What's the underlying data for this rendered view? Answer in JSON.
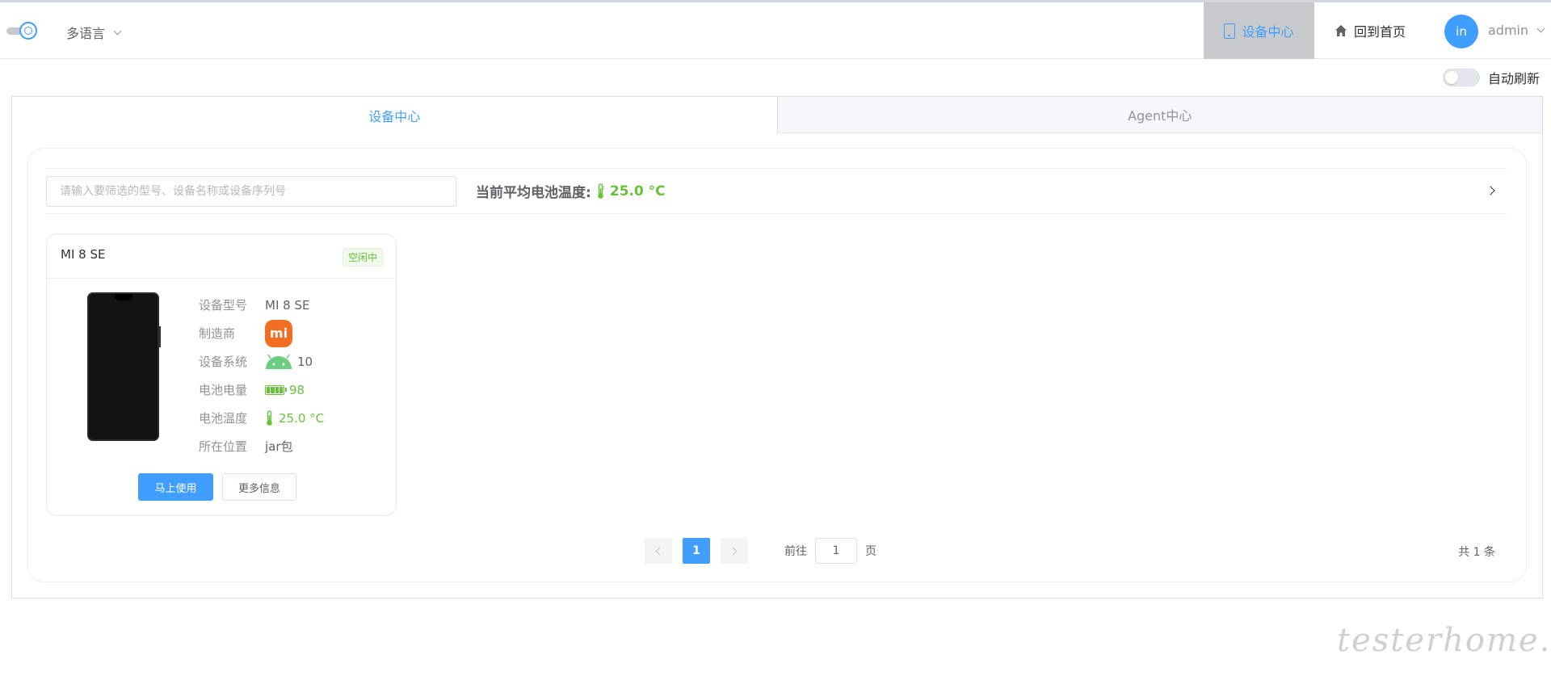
{
  "header": {
    "language_label": "多语言",
    "nav_device_center": "设备中心",
    "nav_home": "回到首页",
    "avatar_text": "in",
    "username": "admin"
  },
  "toolbar": {
    "auto_refresh_label": "自动刷新",
    "auto_refresh_on": false
  },
  "tabs": [
    {
      "label": "设备中心",
      "active": true
    },
    {
      "label": "Agent中心",
      "active": false
    }
  ],
  "filter": {
    "search_placeholder": "请输入要筛选的型号、设备名称或设备序列号",
    "avg_temp_label": "当前平均电池温度:",
    "avg_temp_value": "25.0 °C"
  },
  "devices": [
    {
      "name": "MI 8 SE",
      "status": "空闲中",
      "fields": [
        {
          "label": "设备型号",
          "value": "MI 8 SE",
          "icon": "none"
        },
        {
          "label": "制造商",
          "value": "",
          "icon": "xiaomi-logo",
          "logo_text": "mi"
        },
        {
          "label": "设备系统",
          "value": "10",
          "icon": "android-icon"
        },
        {
          "label": "电池电量",
          "value": "98",
          "icon": "battery-icon"
        },
        {
          "label": "电池温度",
          "value": "25.0 °C",
          "icon": "thermometer-icon"
        },
        {
          "label": "所在位置",
          "value": "jar包",
          "icon": "none"
        }
      ],
      "use_button": "马上使用",
      "info_button": "更多信息"
    }
  ],
  "pagination": {
    "current_page": "1",
    "goto_prefix": "前往",
    "goto_value": "1",
    "goto_suffix": "页",
    "total_text": "共 1 条"
  },
  "watermark": "testerhome.com",
  "colors": {
    "accent": "#409eff",
    "success": "#67c23a",
    "xiaomi": "#f26e22",
    "nav_active_bg": "#c8c9cc"
  }
}
